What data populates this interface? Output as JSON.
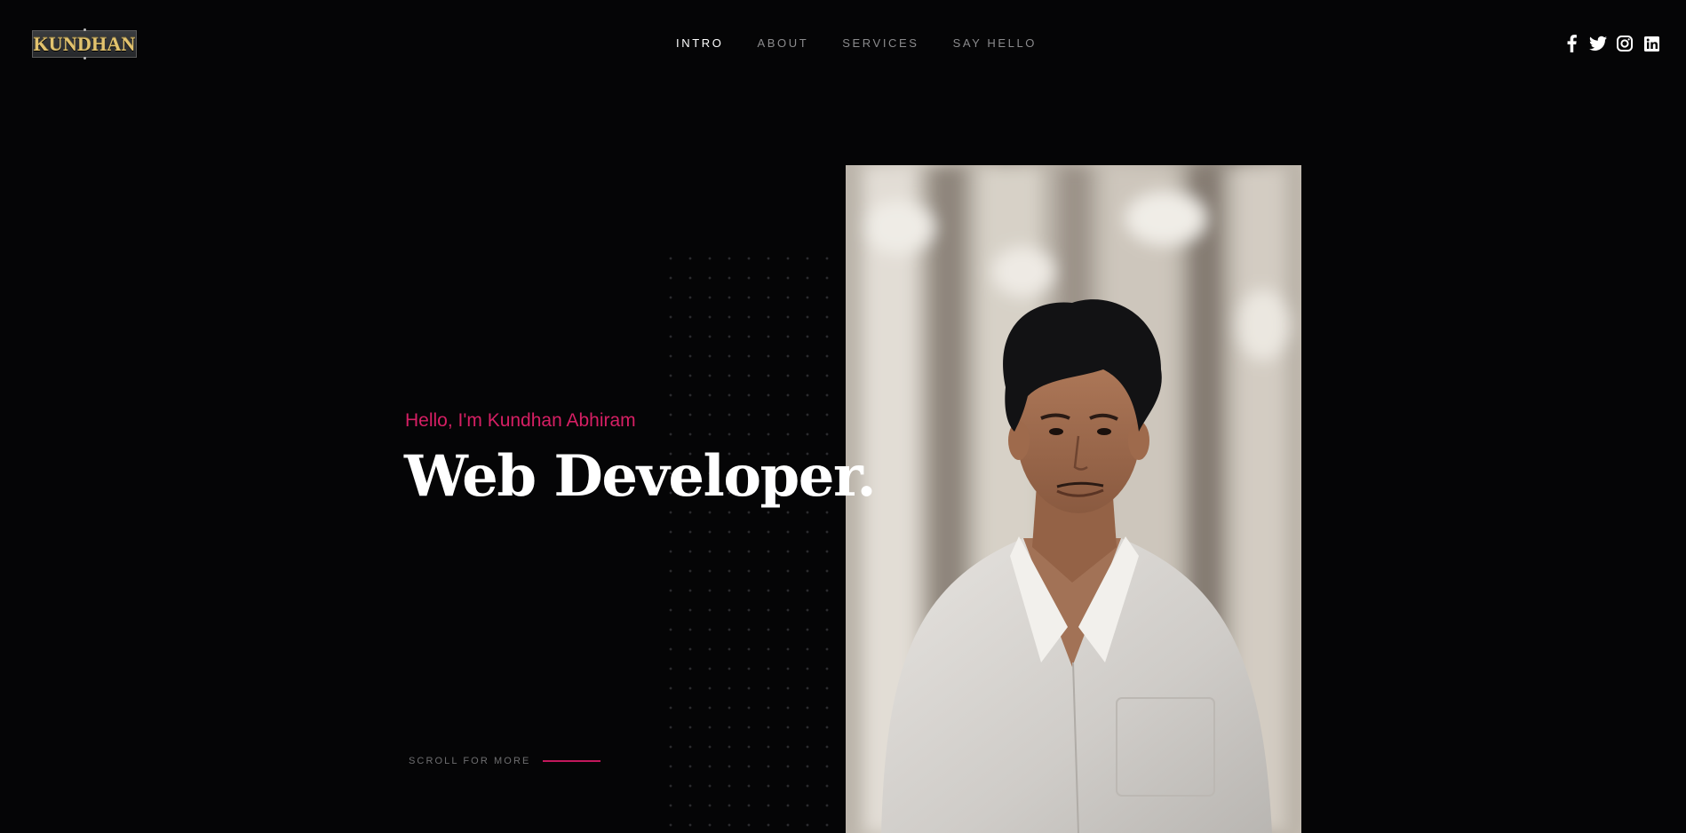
{
  "header": {
    "logo_text": "KUNDHAN",
    "nav": [
      {
        "label": "INTRO",
        "active": true
      },
      {
        "label": "ABOUT",
        "active": false
      },
      {
        "label": "SERVICES",
        "active": false
      },
      {
        "label": "SAY HELLO",
        "active": false
      }
    ],
    "socials": [
      "facebook-icon",
      "twitter-icon",
      "instagram-icon",
      "linkedin-icon"
    ]
  },
  "hero": {
    "greeting": "Hello, I'm Kundhan Abhiram",
    "headline": "Web Developer.",
    "scroll_label": "SCROLL FOR MORE"
  },
  "colors": {
    "background": "#050506",
    "accent": "#d61f64",
    "nav_inactive": "#8b8b8d",
    "nav_active": "#ffffff"
  }
}
